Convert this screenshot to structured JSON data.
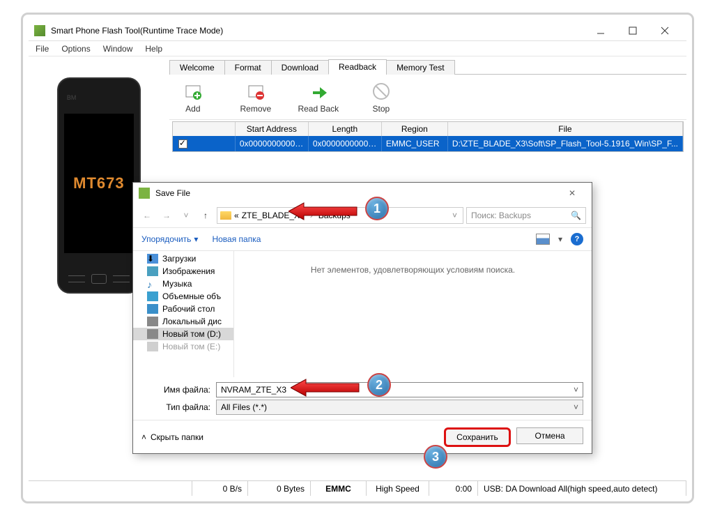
{
  "window": {
    "title": "Smart Phone Flash Tool(Runtime Trace Mode)"
  },
  "menubar": {
    "file": "File",
    "options": "Options",
    "window": "Window",
    "help": "Help"
  },
  "phone": {
    "bm": "BM",
    "chip": "MT673"
  },
  "tabs": {
    "welcome": "Welcome",
    "format": "Format",
    "download": "Download",
    "readback": "Readback",
    "memtest": "Memory Test"
  },
  "toolbar": {
    "add": "Add",
    "remove": "Remove",
    "readback": "Read Back",
    "stop": "Stop"
  },
  "table": {
    "head": {
      "addr": "Start Address",
      "len": "Length",
      "region": "Region",
      "file": "File"
    },
    "row": {
      "addr": "0x000000000000...",
      "len": "0x000000000000...",
      "region": "EMMC_USER",
      "file": "D:\\ZTE_BLADE_X3\\Soft\\SP_Flash_Tool-5.1916_Win\\SP_F..."
    }
  },
  "status": {
    "speed": "0 B/s",
    "bytes": "0 Bytes",
    "type": "EMMC",
    "mode": "High Speed",
    "time": "0:00",
    "usb": "USB: DA Download All(high speed,auto detect)"
  },
  "dialog": {
    "title": "Save File",
    "crumb_prefix": "«",
    "crumb1": "ZTE_BLADE_X3",
    "crumb2": "Backups",
    "search_placeholder": "Поиск: Backups",
    "organize": "Упорядочить",
    "newfolder": "Новая папка",
    "empty": "Нет элементов, удовлетворяющих условиям поиска.",
    "nav": {
      "downloads": "Загрузки",
      "images": "Изображения",
      "music": "Музыка",
      "objects3d": "Объемные объ",
      "desktop": "Рабочий стол",
      "localdisk": "Локальный дис",
      "newvolD": "Новый том (D:)",
      "newvolE": "Новый том (E:)"
    },
    "filename_label": "Имя файла:",
    "filename_value": "NVRAM_ZTE_X3",
    "filetype_label": "Тип файла:",
    "filetype_value": "All Files (*.*)",
    "hide_folders": "Скрыть папки",
    "save_btn": "Сохранить",
    "cancel_btn": "Отмена"
  },
  "anno": {
    "b1": "1",
    "b2": "2",
    "b3": "3"
  }
}
